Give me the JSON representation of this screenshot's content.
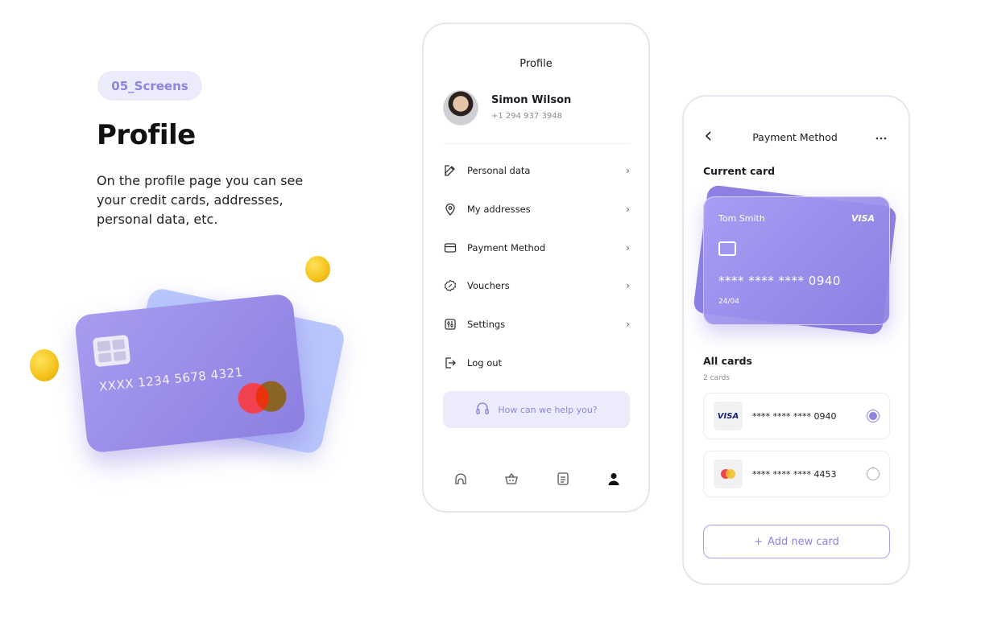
{
  "intro": {
    "tag": "05_Screens",
    "title": "Profile",
    "description_lines": [
      "On the profile page you can see",
      "your credit cards, addresses,",
      "personal data, etc."
    ]
  },
  "illustration": {
    "card_number": "XXXX 1234 5678 4321"
  },
  "profile_screen": {
    "header": "Profile",
    "user_name": "Simon Wilson",
    "user_phone": "+1 294 937 3948",
    "menu": [
      {
        "label": "Personal data",
        "icon": "edit-icon"
      },
      {
        "label": "My addresses",
        "icon": "location-pin-icon"
      },
      {
        "label": "Payment Method",
        "icon": "credit-card-icon"
      },
      {
        "label": "Vouchers",
        "icon": "voucher-icon"
      },
      {
        "label": "Settings",
        "icon": "settings-icon"
      },
      {
        "label": "Log out",
        "icon": "logout-icon"
      }
    ],
    "help_label": "How can we help you?",
    "tabs": [
      "home-icon",
      "basket-icon",
      "document-icon",
      "user-icon"
    ],
    "active_tab": "user-icon"
  },
  "payment_screen": {
    "header": "Payment Method",
    "current_card_label": "Current card",
    "card": {
      "holder": "Tom Smith",
      "brand": "VISA",
      "number": "**** **** **** 0940",
      "expiry": "24/04"
    },
    "all_cards_label": "All cards",
    "all_cards_count": "2 cards",
    "cards": [
      {
        "brand": "VISA",
        "number": "**** **** **** 0940",
        "selected": true
      },
      {
        "brand": "mastercard",
        "number": "**** **** **** 4453",
        "selected": false
      }
    ],
    "add_button": "Add new card"
  },
  "colors": {
    "accent": "#8c84e0",
    "accent_light": "#ecebfb",
    "card_purple": "#9a8eea",
    "coin_yellow": "#f4c21a",
    "mastercard_red": "#f3424f",
    "mastercard_yellow": "#f5c22a"
  }
}
